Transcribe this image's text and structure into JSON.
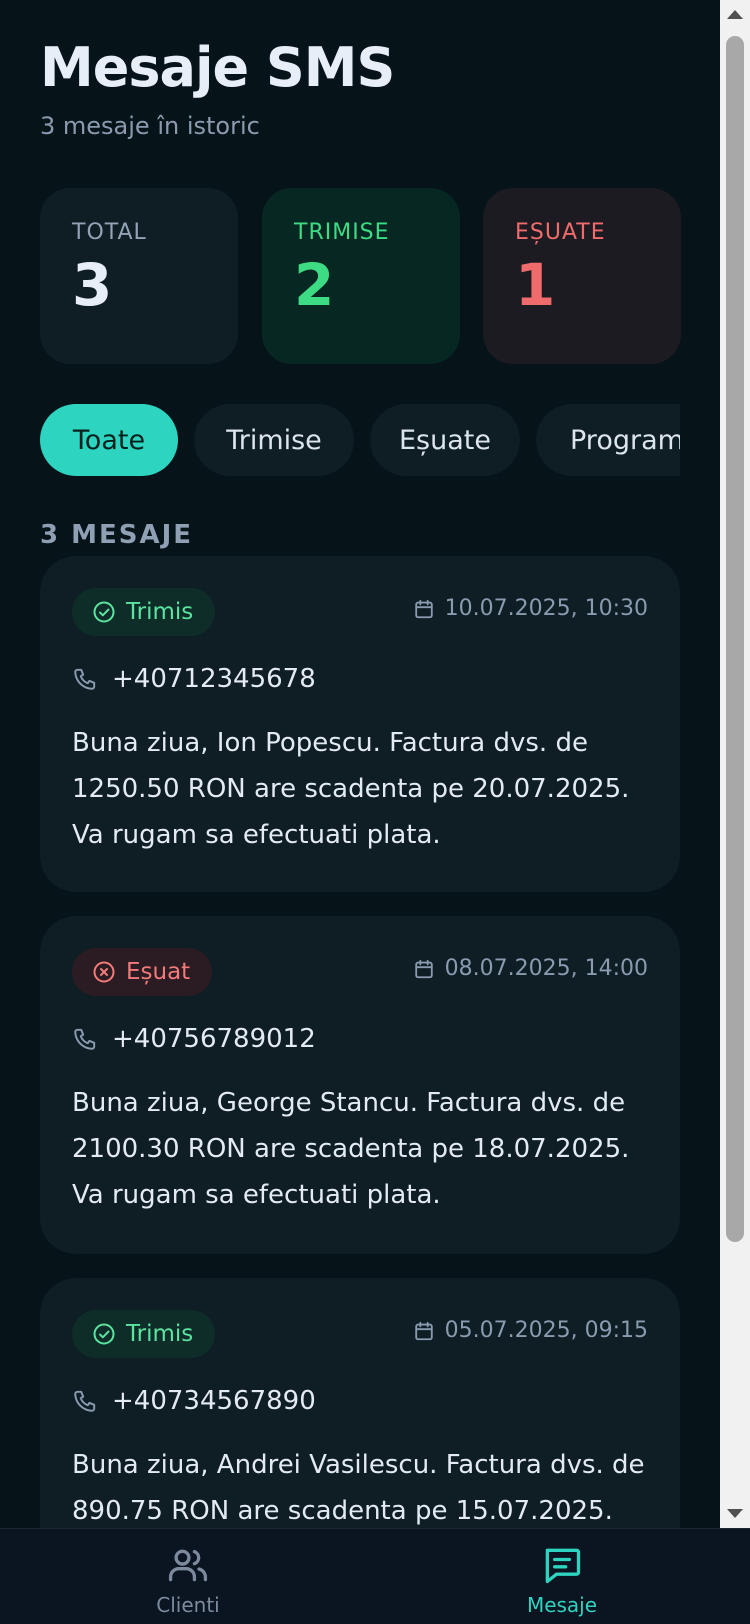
{
  "header": {
    "title": "Mesaje SMS",
    "subtitle": "3 mesaje în istoric"
  },
  "stats": [
    {
      "label": "TOTAL",
      "value": "3"
    },
    {
      "label": "TRIMISE",
      "value": "2"
    },
    {
      "label": "EȘUATE",
      "value": "1"
    }
  ],
  "filters": [
    {
      "label": "Toate",
      "active": true
    },
    {
      "label": "Trimise",
      "active": false
    },
    {
      "label": "Eșuate",
      "active": false
    },
    {
      "label": "Programate",
      "active": false
    }
  ],
  "list": {
    "section_label": "3 MESAJE",
    "messages": [
      {
        "status": "Trimis",
        "status_type": "sent",
        "date": "10.07.2025, 10:30",
        "phone": "+40712345678",
        "text": "Buna ziua, Ion Popescu. Factura dvs. de 1250.50 RON are scadenta pe 20.07.2025. Va rugam sa efectuati plata."
      },
      {
        "status": "Eșuat",
        "status_type": "failed",
        "date": "08.07.2025, 14:00",
        "phone": "+40756789012",
        "text": "Buna ziua, George Stancu. Factura dvs. de 2100.30 RON are scadenta pe 18.07.2025. Va rugam sa efectuati plata."
      },
      {
        "status": "Trimis",
        "status_type": "sent",
        "date": "05.07.2025, 09:15",
        "phone": "+40734567890",
        "text": "Buna ziua, Andrei Vasilescu. Factura dvs. de 890.75 RON are scadenta pe 15.07.2025. Va rugam sa efectuati plata."
      }
    ]
  },
  "nav": {
    "clients_label": "Clienti",
    "messages_label": "Mesaje",
    "active": "messages"
  },
  "colors": {
    "accent": "#2dd4bf",
    "sent": "#3ddc84",
    "failed": "#f06b6b",
    "background": "#061319"
  }
}
